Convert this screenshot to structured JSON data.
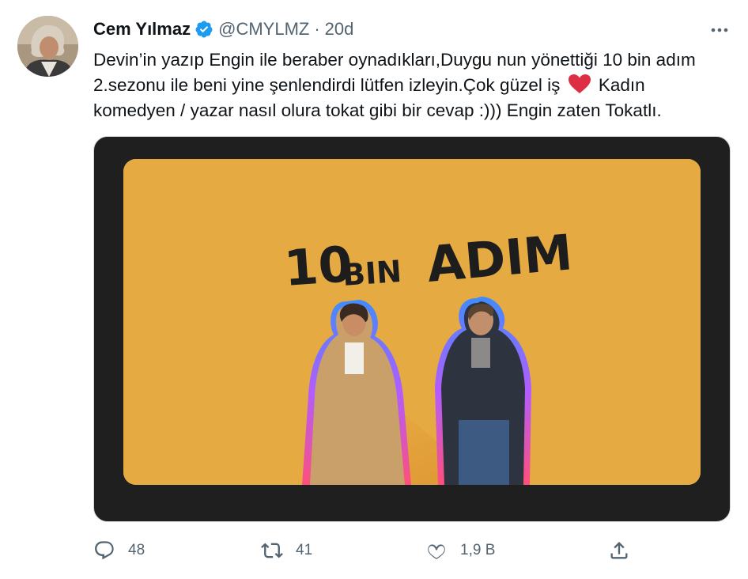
{
  "user": {
    "name": "Cem Yılmaz",
    "handle": "@CMYLMZ",
    "separator": "·",
    "time": "20d"
  },
  "tweet": {
    "text_before_heart": "Devin’in yazıp Engin ile beraber oynadıkları,Duygu nun yönettiği 10 bin adım 2.sezonu ile beni yine şenlendirdi lütfen izleyin.Çok güzel iş",
    "text_after_heart": "Kadın komedyen / yazar nasıl olura tokat gibi bir cevap :))) Engin zaten Tokatlı."
  },
  "media": {
    "poster_title": "10 BIN ADIM",
    "background_color": "#e2a63c",
    "frame_color": "#1f1f1f"
  },
  "actions": {
    "replies": "48",
    "retweets": "41",
    "likes": "1,9 B"
  },
  "icons": {
    "verified": "verified-badge-icon",
    "more": "more-options-icon",
    "reply": "reply-icon",
    "retweet": "retweet-icon",
    "like": "heart-icon",
    "share": "share-icon",
    "emoji": "red-heart-emoji"
  },
  "colors": {
    "verified_blue": "#1d9bf0",
    "muted_text": "#536471",
    "heart_red": "#e0245e"
  }
}
